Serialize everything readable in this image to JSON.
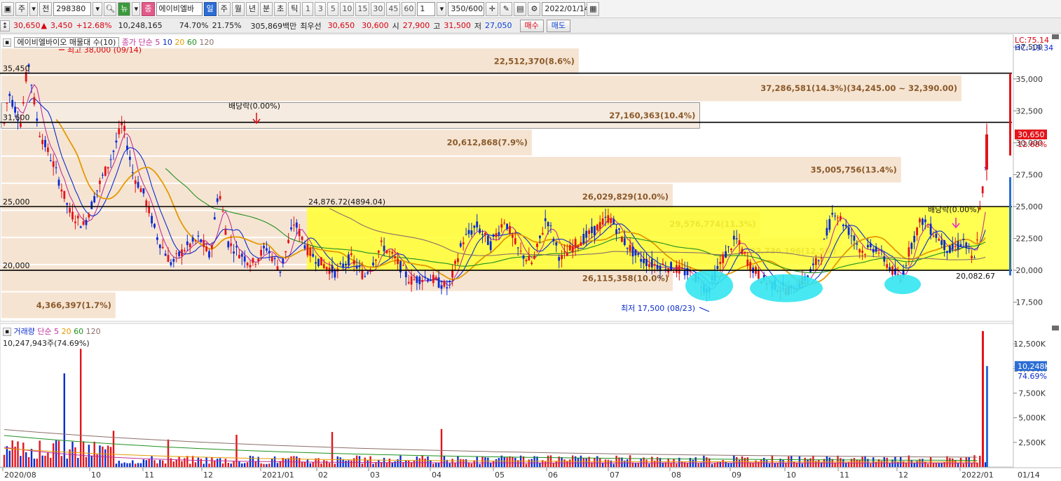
{
  "toolbar": {
    "period_label": "주",
    "compare_label": "전",
    "code": "298380",
    "news_label": "뉴",
    "stock_badge": "종",
    "stock_name": "에이비엘바",
    "timeframes": [
      "일",
      "주",
      "월",
      "년",
      "분",
      "초",
      "틱"
    ],
    "minute_options": [
      "1",
      "3",
      "5",
      "10",
      "15",
      "30",
      "45",
      "60"
    ],
    "unit_value": "1",
    "count_display": "350/600",
    "date": "2022/01/14"
  },
  "quote": {
    "price": "30,650",
    "arrow": "▲",
    "change": "3,450",
    "change_pct": "+12.68%",
    "volume": "10,248,165",
    "vol_ratio": "74.70%",
    "turnover": "21.75%",
    "amount": "305,869백만",
    "best_label": "최우선",
    "best_ask": "30,650",
    "best_bid": "30,600",
    "open_label": "시",
    "open": "27,900",
    "high_label": "고",
    "high": "31,500",
    "low_label": "저",
    "low": "27,050",
    "buy_label": "매수",
    "sell_label": "매도"
  },
  "price_panel": {
    "legend_main": "에이비엘바이오 매물대 수(10)",
    "legend_ma": "종가 단순 5",
    "ma_periods": [
      "10",
      "20",
      "60",
      "120"
    ],
    "ma_colors": [
      "#c0329a",
      "#0a2bd0",
      "#e39a00",
      "#1f8f1f",
      "#8a6f6a"
    ],
    "high_note": "최고 38,000 (09/14)",
    "low_note": "최저 17,500 (08/23)",
    "ex_div_1": "배당락(0.00%)",
    "ex_div_2": "배당락(0.00%)",
    "lc": "LC:75.14",
    "hc": "HC:-19.34",
    "current_price_tag": "30,650",
    "current_pct_tag": "12.68%",
    "level_labels": [
      "35,450",
      "31,600",
      "25,000",
      "20,000"
    ],
    "box_note": "24,876.72(4894.04)",
    "last_low_label": "20,082.67",
    "volume_profile_labels": [
      "22,512,370(8.6%)",
      "37,286,581(14.3%)(34,245.00 ~ 32,390.00)",
      "27,160,363(10.4%)",
      "20,612,868(7.9%)",
      "35,005,756(13.4%)",
      "26,029,829(10.0%)",
      "29,576,774(11.3%)",
      "32,736,196(12.5%)",
      "26,115,358(10.0%)",
      "4,366,397(1.7%)"
    ],
    "y_ticks": [
      "37,500",
      "35,000",
      "32,500",
      "30,000",
      "27,500",
      "25,000",
      "22,500",
      "20,000",
      "17,500"
    ]
  },
  "volume_panel": {
    "legend_main": "거래량",
    "legend_ma": "단순 5",
    "ma_periods": [
      "20",
      "60",
      "120"
    ],
    "volume_text": "10,247,943주(74.69%)",
    "current_tag": "10,248K",
    "current_pct": "74.69%",
    "y_ticks": [
      "12,500K",
      "10,000K",
      "7,500K",
      "5,000K",
      "2,500K"
    ]
  },
  "x_axis": {
    "labels": [
      "2020/08",
      "10",
      "11",
      "12",
      "2021/01",
      "02",
      "03",
      "04",
      "05",
      "06",
      "07",
      "08",
      "09",
      "10",
      "11",
      "12",
      "2022/01"
    ],
    "last_date": "01/14"
  },
  "chart_data": {
    "type": "candlestick",
    "period": "weekly",
    "x_range": [
      "2020-08",
      "2022-01-14"
    ],
    "ylim": [
      16000,
      38500
    ],
    "horizontal_lines": [
      35450,
      31600,
      25000,
      20000
    ],
    "highest": {
      "value": 38000,
      "date": "09/14"
    },
    "lowest": {
      "value": 17500,
      "date": "08/23"
    },
    "last": {
      "open": 27900,
      "high": 31500,
      "low": 27050,
      "close": 30650
    },
    "volume_profile": [
      {
        "volume": 22512370,
        "pct": 8.6
      },
      {
        "volume": 37286581,
        "pct": 14.3,
        "range": [
          34245.0,
          32390.0
        ]
      },
      {
        "volume": 27160363,
        "pct": 10.4
      },
      {
        "volume": 20612868,
        "pct": 7.9
      },
      {
        "volume": 35005756,
        "pct": 13.4
      },
      {
        "volume": 26029829,
        "pct": 10.0
      },
      {
        "volume": 29576774,
        "pct": 11.3
      },
      {
        "volume": 32736196,
        "pct": 12.5
      },
      {
        "volume": 26115358,
        "pct": 10.0
      },
      {
        "volume": 4366397,
        "pct": 1.7
      }
    ],
    "volume_ylim": [
      0,
      14000000
    ],
    "last_volume": 10247943
  }
}
